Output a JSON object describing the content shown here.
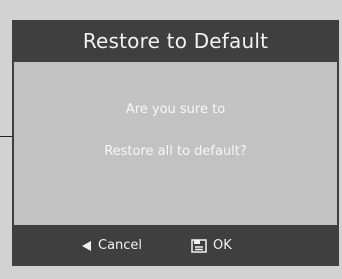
{
  "dialog": {
    "title": "Restore to Default",
    "message_line1": "Are you sure to",
    "message_line2": "Restore all to default?"
  },
  "softkeys": {
    "cancel": {
      "label": "Cancel",
      "icon": "back-arrow-icon"
    },
    "ok": {
      "label": "OK",
      "icon": "ok-key-icon"
    }
  },
  "colors": {
    "background": "#d2d2d2",
    "dialog_body": "#c2c2c2",
    "bars": "#3f3f3f",
    "text": "#f2f2f2"
  }
}
